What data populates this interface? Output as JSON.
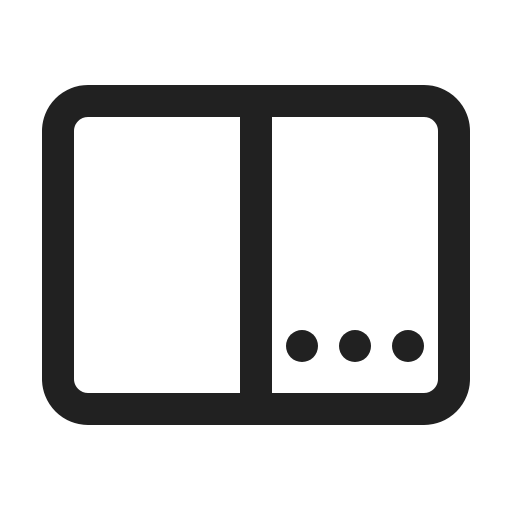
{
  "icon": {
    "name": "split-view-with-more-icon",
    "stroke_color": "#212121",
    "background_color": "#ffffff"
  }
}
